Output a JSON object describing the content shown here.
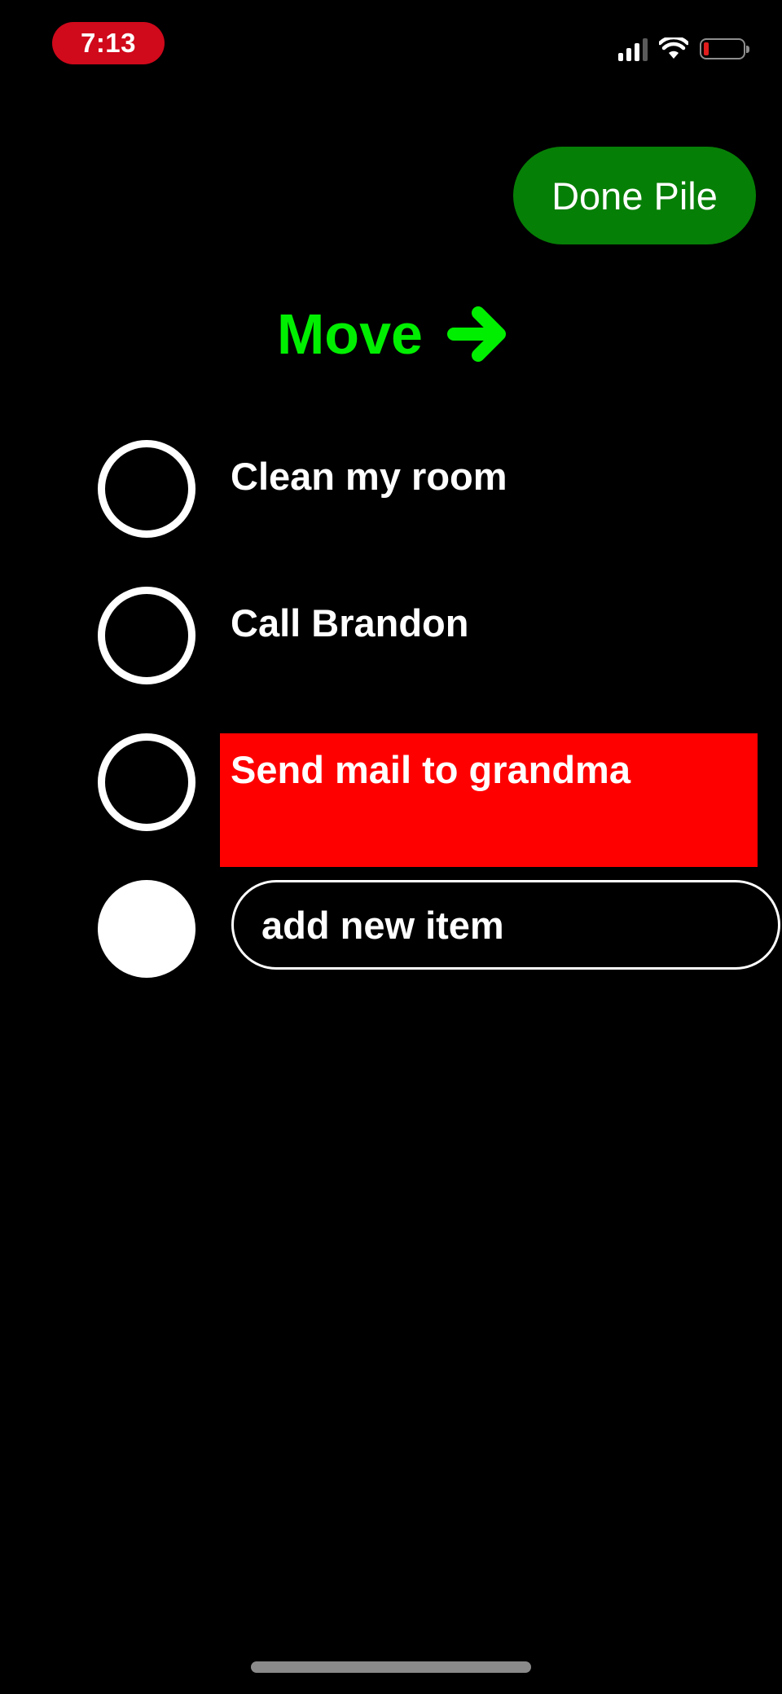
{
  "status_bar": {
    "time": "7:13",
    "icons": [
      "cellular-signal-icon",
      "wifi-icon",
      "battery-low-icon"
    ]
  },
  "header": {
    "done_pile_label": "Done Pile",
    "move_label": "Move",
    "move_icon": "arrow-right-icon"
  },
  "tasks": [
    {
      "label": "Clean my room",
      "completed": false
    },
    {
      "label": "Call Brandon",
      "completed": false
    },
    {
      "label": "Send mail to grandma",
      "completed": false,
      "highlighted": true
    }
  ],
  "new_item": {
    "placeholder": "add new item",
    "value": ""
  },
  "colors": {
    "background": "#000000",
    "done_pile_button": "#067f06",
    "move_accent": "#00ef00",
    "highlight": "#ff0000",
    "time_pill": "#d0091b"
  }
}
